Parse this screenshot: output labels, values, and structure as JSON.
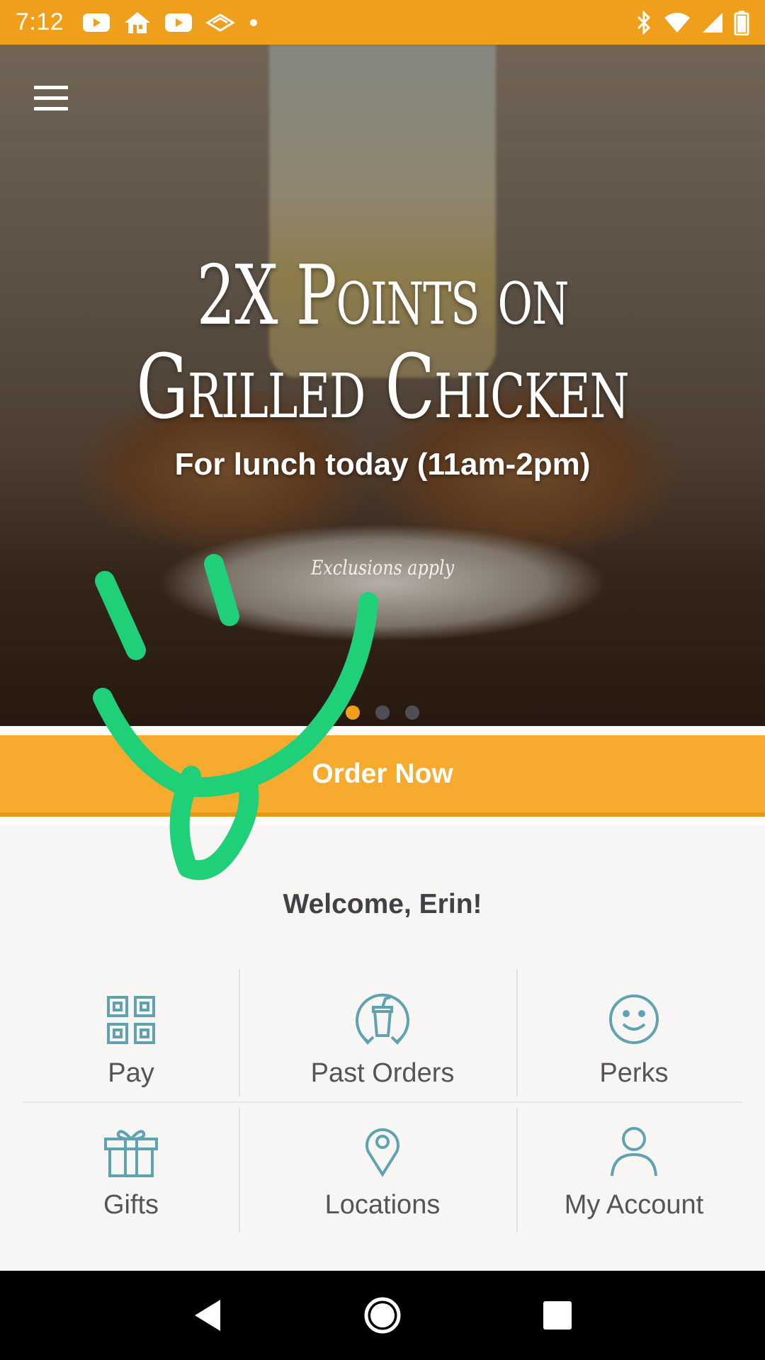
{
  "status_bar": {
    "time": "7:12",
    "left_icons": [
      "youtube-icon",
      "home-icon",
      "youtube-icon",
      "wireless-icon",
      "dot-icon"
    ],
    "right_icons": [
      "bluetooth-icon",
      "wifi-icon",
      "cell-signal-icon",
      "battery-icon"
    ],
    "color": "#ef9f1b"
  },
  "hero": {
    "promo_line1": "2X Points on",
    "promo_line2": "Grilled Chicken",
    "subtitle": "For lunch today (11am-2pm)",
    "exclusions": "Exclusions apply",
    "carousel_dots": 3,
    "active_dot": 0
  },
  "order": {
    "label": "Order Now",
    "color": "#f6ab2e"
  },
  "welcome": "Welcome, Erin!",
  "tiles": [
    {
      "label": "Pay",
      "icon": "qr-code-icon"
    },
    {
      "label": "Past Orders",
      "icon": "cup-refresh-icon"
    },
    {
      "label": "Perks",
      "icon": "smiley-icon"
    },
    {
      "label": "Gifts",
      "icon": "gift-icon"
    },
    {
      "label": "Locations",
      "icon": "location-pin-icon"
    },
    {
      "label": "My Account",
      "icon": "person-icon"
    }
  ],
  "accent_icon_color": "#5fa3b0",
  "nav": {
    "buttons": [
      "back-icon",
      "home-icon",
      "recents-icon"
    ]
  },
  "annotation": {
    "color": "#1fd078"
  }
}
